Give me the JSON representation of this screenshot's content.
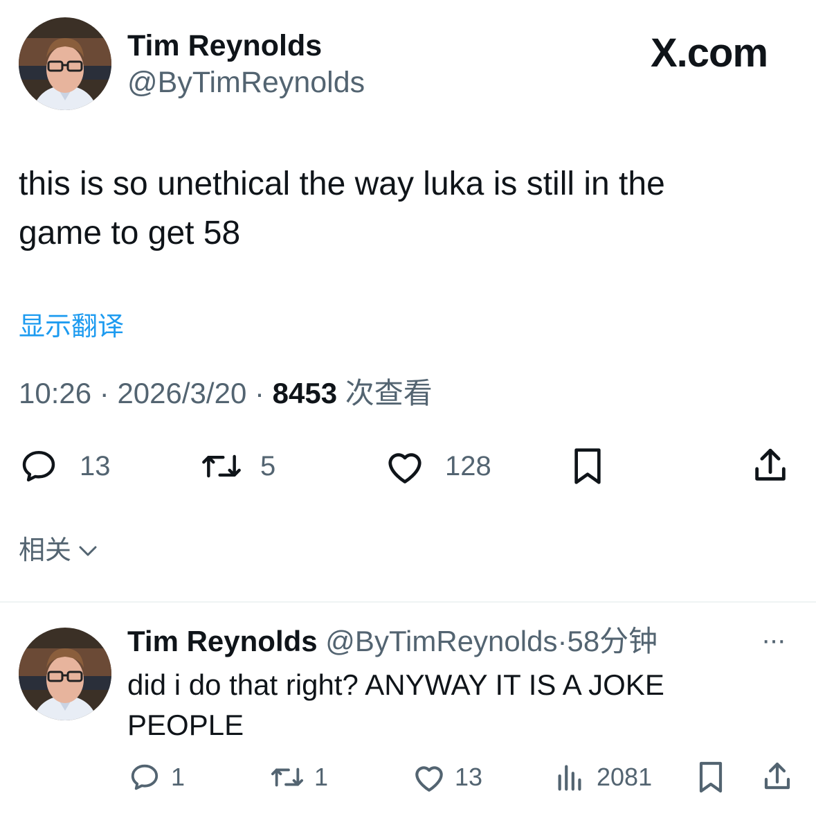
{
  "main_tweet": {
    "author_name": "Tim Reynolds",
    "author_handle": "@ByTimReynolds",
    "site_logo": "X.com",
    "text": "this is so unethical the way luka is still in the game to get 58",
    "translate_link": "显示翻译",
    "time": "10:26",
    "separator": "·",
    "date": "2026/3/20",
    "views_count": "8453",
    "views_label": "次查看",
    "actions": {
      "reply_count": "13",
      "retweet_count": "5",
      "like_count": "128"
    },
    "related_label": "相关"
  },
  "reply_tweet": {
    "author_name": "Tim Reynolds",
    "author_handle": "@ByTimReynolds",
    "separator": "·",
    "time_ago": "58分钟",
    "more": "···",
    "text": "did i do that right? ANYWAY IT IS A JOKE PEOPLE",
    "actions": {
      "reply_count": "1",
      "retweet_count": "1",
      "like_count": "13",
      "views_count": "2081"
    }
  },
  "icons": [
    "reply-icon",
    "retweet-icon",
    "like-icon",
    "bookmark-icon",
    "share-icon",
    "views-icon",
    "chevron-down-icon",
    "more-icon"
  ],
  "colors": {
    "text": "#0f1419",
    "secondary": "#536471",
    "link": "#1d9bf0",
    "divider": "#eff3f4"
  }
}
